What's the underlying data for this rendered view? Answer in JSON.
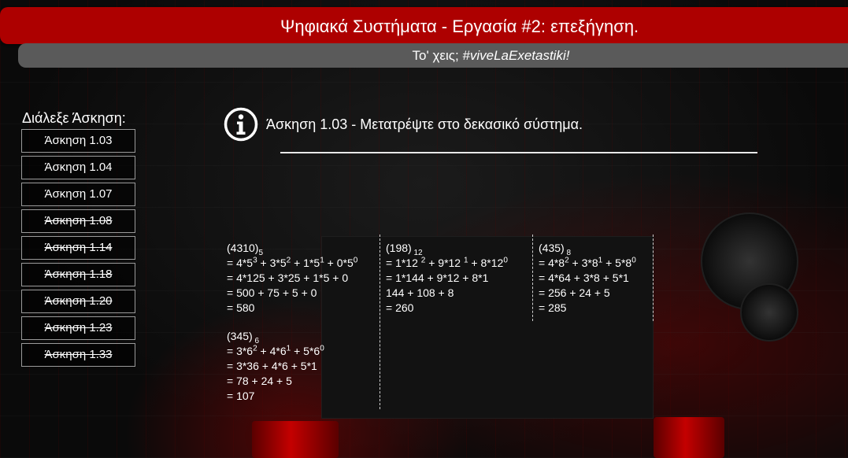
{
  "header": {
    "title": "Ψηφιακά Συστήματα - Εργασία #2: επεξήγηση.",
    "subtitle_prefix": "Το' χεις; ",
    "subtitle_tag": "#viveLaExetastiki!"
  },
  "sidebar": {
    "title": "Διάλεξε Άσκηση:",
    "items": [
      {
        "label": "Άσκηση 1.03",
        "struck": false
      },
      {
        "label": "Άσκηση 1.04",
        "struck": false
      },
      {
        "label": "Άσκηση 1.07",
        "struck": false
      },
      {
        "label": "Άσκηση 1.08",
        "struck": true
      },
      {
        "label": "Άσκηση 1.14",
        "struck": true
      },
      {
        "label": "Άσκηση 1.18",
        "struck": true
      },
      {
        "label": "Άσκηση 1.20",
        "struck": true
      },
      {
        "label": "Άσκηση 1.23",
        "struck": true
      },
      {
        "label": "Άσκηση 1.33",
        "struck": true
      }
    ]
  },
  "exercise": {
    "icon": "info-icon",
    "heading": "Άσκηση 1.03 - Μετατρέψτε στο δεκασικό σύστημα.",
    "solutions": [
      {
        "number": "4310",
        "base": "5",
        "lines": [
          [
            [
              "= 4*5",
              ""
            ],
            [
              "3",
              "sup"
            ],
            [
              " + 3*5",
              ""
            ],
            [
              "2",
              "sup"
            ],
            [
              " + 1*5",
              ""
            ],
            [
              "1",
              "sup"
            ],
            [
              " + 0*5",
              ""
            ],
            [
              "0",
              "sup"
            ]
          ],
          [
            [
              "= 4*125 + 3*25 + 1*5 + 0",
              ""
            ]
          ],
          [
            [
              "= 500 + 75 + 5 + 0",
              ""
            ]
          ],
          [
            [
              "= 580",
              ""
            ]
          ]
        ]
      },
      {
        "number": "198",
        "base": "12",
        "lines": [
          [
            [
              "= 1*12 ",
              ""
            ],
            [
              "2",
              "sup"
            ],
            [
              " + 9*12 ",
              ""
            ],
            [
              "1",
              "sup"
            ],
            [
              " + 8*12",
              ""
            ],
            [
              "0",
              "sup"
            ]
          ],
          [
            [
              "= 1*144 + 9*12 + 8*1",
              ""
            ]
          ],
          [
            [
              "144 + 108 + 8",
              ""
            ]
          ],
          [
            [
              "= 260",
              ""
            ]
          ]
        ]
      },
      {
        "number": "435",
        "base": "8",
        "lines": [
          [
            [
              "= 4*8",
              ""
            ],
            [
              "2",
              "sup"
            ],
            [
              " + 3*8",
              ""
            ],
            [
              "1",
              "sup"
            ],
            [
              " + 5*8",
              ""
            ],
            [
              "0",
              "sup"
            ]
          ],
          [
            [
              "= 4*64 + 3*8 + 5*1",
              ""
            ]
          ],
          [
            [
              "= 256 + 24 + 5",
              ""
            ]
          ],
          [
            [
              "= 285",
              ""
            ]
          ]
        ]
      },
      {
        "number": "345",
        "base": "6",
        "lines": [
          [
            [
              "= 3*6",
              ""
            ],
            [
              "2",
              "sup"
            ],
            [
              " + 4*6",
              ""
            ],
            [
              "1",
              "sup"
            ],
            [
              " + 5*6",
              ""
            ],
            [
              "0",
              "sup"
            ]
          ],
          [
            [
              "= 3*36 + 4*6 + 5*1",
              ""
            ]
          ],
          [
            [
              "= 78 + 24 + 5",
              ""
            ]
          ],
          [
            [
              "= 107",
              ""
            ]
          ]
        ]
      }
    ]
  },
  "colors": {
    "title_bar": "#ad0000",
    "subtitle_bar": "#5a5a5a",
    "text": "#ffffff"
  }
}
